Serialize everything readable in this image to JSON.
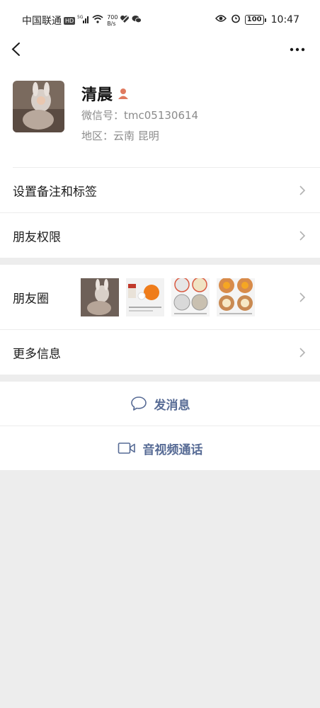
{
  "status_bar": {
    "carrier": "中国联通",
    "hd_badge": "HD",
    "network": "5G",
    "speed_value": "700",
    "speed_unit": "B/s",
    "battery": "100",
    "time": "10:47"
  },
  "profile": {
    "name": "清晨",
    "wechat_id": "微信号：tmc05130614",
    "region": "地区：云南  昆明"
  },
  "menu": {
    "remark_tags": "设置备注和标签",
    "friend_permissions": "朋友权限",
    "moments": "朋友圈",
    "more_info": "更多信息"
  },
  "actions": {
    "send_message": "发消息",
    "video_call": "音视频通话"
  },
  "colors": {
    "link_blue": "#576b95",
    "page_bg": "#ededed",
    "gender_icon": "#e07a5f"
  },
  "icons": [
    "back-arrow-icon",
    "more-dots-icon",
    "chevron-right-icon",
    "chat-bubble-icon",
    "video-camera-icon",
    "person-gender-icon"
  ]
}
